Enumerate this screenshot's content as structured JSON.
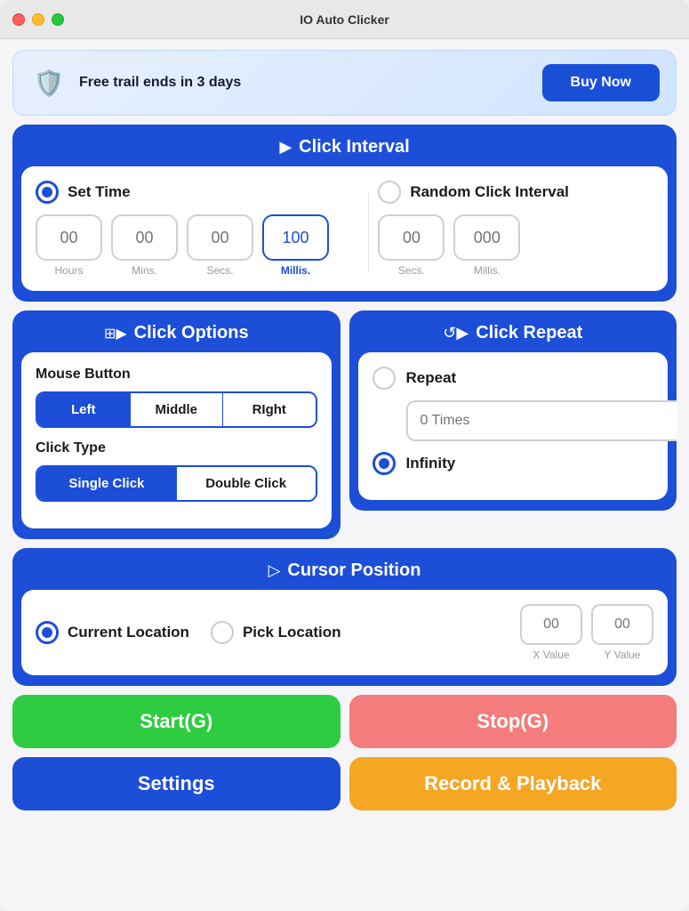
{
  "window": {
    "title": "IO Auto Clicker"
  },
  "trial": {
    "text": "Free trail ends in 3 days",
    "buy_label": "Buy Now",
    "icon": "🛡️"
  },
  "click_interval": {
    "title": "Click Interval",
    "set_time_label": "Set Time",
    "random_label": "Random Click Interval",
    "hours_placeholder": "00",
    "mins_placeholder": "00",
    "secs_placeholder": "00",
    "millis_value": "100",
    "rand_secs_placeholder": "00",
    "rand_millis_placeholder": "000",
    "hours_label": "Hours",
    "mins_label": "Mins.",
    "secs_label": "Secs.",
    "millis_label": "Millis.",
    "rand_secs_label": "Secs.",
    "rand_millis_label": "Millis."
  },
  "click_options": {
    "title": "Click Options",
    "mouse_button_label": "Mouse Button",
    "left_label": "Left",
    "middle_label": "Middle",
    "right_label": "RIght",
    "click_type_label": "Click Type",
    "single_click_label": "Single Click",
    "double_click_label": "Double Click"
  },
  "click_repeat": {
    "title": "Click Repeat",
    "repeat_label": "Repeat",
    "times_placeholder": "0 Times",
    "infinity_label": "Infinity"
  },
  "cursor_position": {
    "title": "Cursor Position",
    "current_label": "Current Location",
    "pick_label": "Pick Location",
    "x_placeholder": "00",
    "y_placeholder": "00",
    "x_label": "X Value",
    "y_label": "Y Value"
  },
  "actions": {
    "start_label": "Start(G)",
    "stop_label": "Stop(G)",
    "settings_label": "Settings",
    "record_label": "Record & Playback"
  }
}
